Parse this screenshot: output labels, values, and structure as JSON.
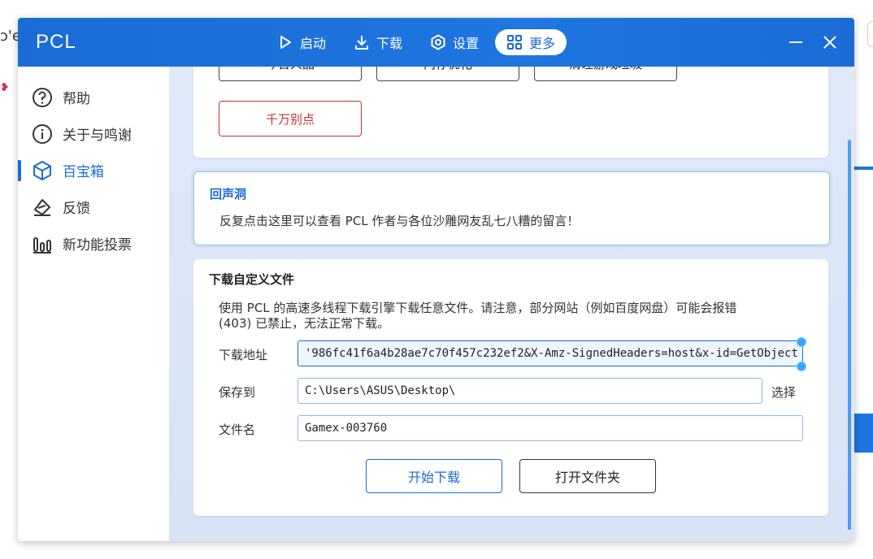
{
  "background": {
    "left_fragment": "ɔ'e"
  },
  "app": {
    "title": "PCL"
  },
  "nav": [
    {
      "label": "启动",
      "icon": "play-icon"
    },
    {
      "label": "下载",
      "icon": "download-icon"
    },
    {
      "label": "设置",
      "icon": "settings-icon"
    },
    {
      "label": "更多",
      "icon": "grid-icon",
      "active": true
    }
  ],
  "sidebar": {
    "items": [
      {
        "label": "帮助",
        "icon": "help-icon"
      },
      {
        "label": "关于与鸣谢",
        "icon": "info-icon"
      },
      {
        "label": "百宝箱",
        "icon": "cube-icon",
        "active": true
      },
      {
        "label": "反馈",
        "icon": "feedback-icon"
      },
      {
        "label": "新功能投票",
        "icon": "vote-icon"
      }
    ]
  },
  "toolbox": {
    "buttons": [
      "今日人品",
      "内存优化",
      "清理游戏垃圾"
    ],
    "danger_button": "千万别点"
  },
  "echo_cave": {
    "title": "回声洞",
    "text": "反复点击这里可以查看 PCL 作者与各位沙雕网友乱七八糟的留言！"
  },
  "custom_download": {
    "title": "下载自定义文件",
    "description_line1": "使用 PCL 的高速多线程下载引擎下载任意文件。请注意，部分网站（例如百度网盘）可能会报错",
    "description_line2": "(403) 已禁止，无法正常下载。",
    "url_label": "下载地址",
    "url_value": "'986fc41f6a4b28ae7c70f457c232ef2&X-Amz-SignedHeaders=host&x-id=GetObject",
    "save_label": "保存到",
    "save_value": "C:\\Users\\ASUS\\Desktop\\",
    "choose_label": "选择",
    "filename_label": "文件名",
    "filename_value": "Gamex-003760",
    "start_button": "开始下载",
    "open_folder_button": "打开文件夹"
  },
  "colors": {
    "accent": "#1a6bd6",
    "danger": "#c03333"
  }
}
